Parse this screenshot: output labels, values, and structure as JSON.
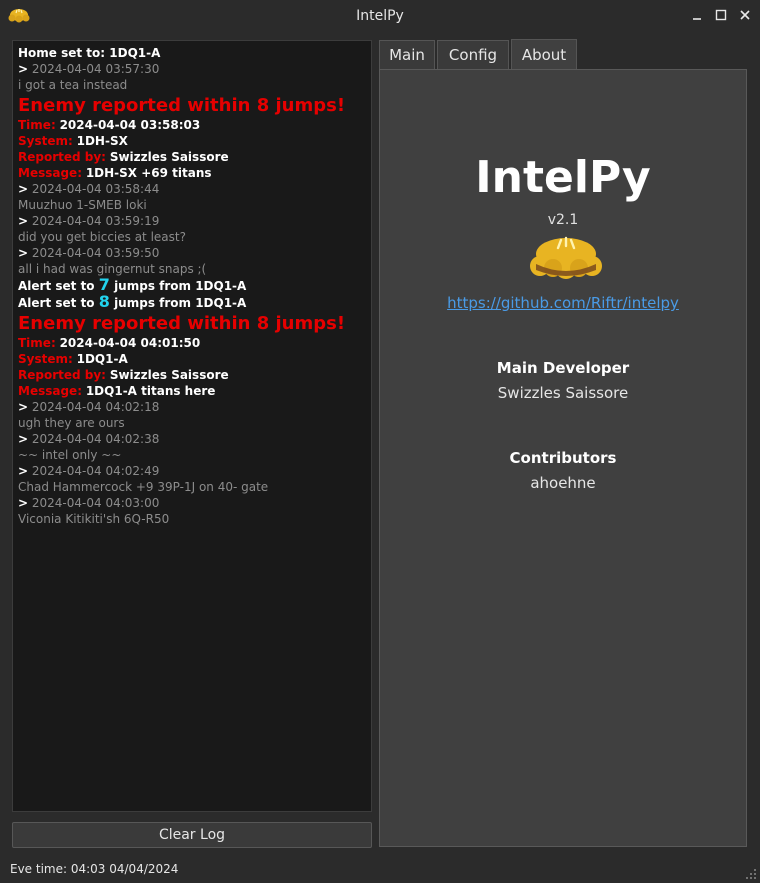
{
  "window": {
    "title": "IntelPy",
    "app_icon": "pie-icon",
    "controls": [
      "minimize-icon",
      "maximize-icon",
      "close-icon"
    ]
  },
  "log": {
    "lines": [
      {
        "kind": "bold",
        "text": "Home set to: 1DQ1-A"
      },
      {
        "kind": "ts",
        "text": "2024-04-04 03:57:30"
      },
      {
        "kind": "msg",
        "text": "i got a tea instead"
      },
      {
        "kind": "alert",
        "text": "Enemy reported within 8 jumps!"
      },
      {
        "kind": "field",
        "label": "Time:",
        "value": "2024-04-04 03:58:03"
      },
      {
        "kind": "field",
        "label": "System:",
        "value": "1DH-SX"
      },
      {
        "kind": "field",
        "label": "Reported by:",
        "value": "Swizzles Saissore"
      },
      {
        "kind": "field",
        "label": "Message:",
        "value": "1DH-SX +69 titans"
      },
      {
        "kind": "ts",
        "text": "2024-04-04 03:58:44"
      },
      {
        "kind": "msg",
        "text": "Muuzhuo 1-SMEB loki"
      },
      {
        "kind": "ts",
        "text": "2024-04-04 03:59:19"
      },
      {
        "kind": "msg",
        "text": "did you get biccies at least?"
      },
      {
        "kind": "ts",
        "text": "2024-04-04 03:59:50"
      },
      {
        "kind": "msg",
        "text": "all i had was gingernut snaps ;("
      },
      {
        "kind": "jumps",
        "pre": "Alert set to",
        "num": "7",
        "post": "jumps from 1DQ1-A"
      },
      {
        "kind": "jumps",
        "pre": "Alert set to",
        "num": "8",
        "post": "jumps from 1DQ1-A"
      },
      {
        "kind": "alert",
        "text": "Enemy reported within 8 jumps!"
      },
      {
        "kind": "field",
        "label": "Time:",
        "value": "2024-04-04 04:01:50"
      },
      {
        "kind": "field",
        "label": "System:",
        "value": "1DQ1-A"
      },
      {
        "kind": "field",
        "label": "Reported by:",
        "value": "Swizzles Saissore"
      },
      {
        "kind": "field",
        "label": "Message:",
        "value": "1DQ1-A titans here"
      },
      {
        "kind": "ts",
        "text": "2024-04-04 04:02:18"
      },
      {
        "kind": "msg",
        "text": "ugh they are ours"
      },
      {
        "kind": "ts",
        "text": "2024-04-04 04:02:38"
      },
      {
        "kind": "msg",
        "text": "~~ intel only ~~"
      },
      {
        "kind": "ts",
        "text": "2024-04-04 04:02:49"
      },
      {
        "kind": "msg",
        "text": "Chad Hammercock +9 39P-1J on 40- gate"
      },
      {
        "kind": "ts",
        "text": "2024-04-04 04:03:00"
      },
      {
        "kind": "msg",
        "text": "Viconia Kitikiti'sh 6Q-R50"
      }
    ],
    "ts_prefix": ">",
    "clear_label": "Clear Log"
  },
  "tabs": [
    {
      "label": "Main",
      "active": false
    },
    {
      "label": "Config",
      "active": false
    },
    {
      "label": "About",
      "active": true
    }
  ],
  "about": {
    "title": "IntelPy",
    "version": "v2.1",
    "logo": "pie-icon",
    "link": "https://github.com/Riftr/intelpy",
    "developer_heading": "Main Developer",
    "developer_name": "Swizzles Saissore",
    "contributors_heading": "Contributors",
    "contributors": [
      "ahoehne"
    ]
  },
  "status": {
    "text": "Eve time: 04:03 04/04/2024"
  },
  "colors": {
    "alert_red": "#e60000",
    "jump_cyan": "#22d3ee",
    "link_blue": "#4a9be6",
    "pie_crust": "#e8b422"
  }
}
